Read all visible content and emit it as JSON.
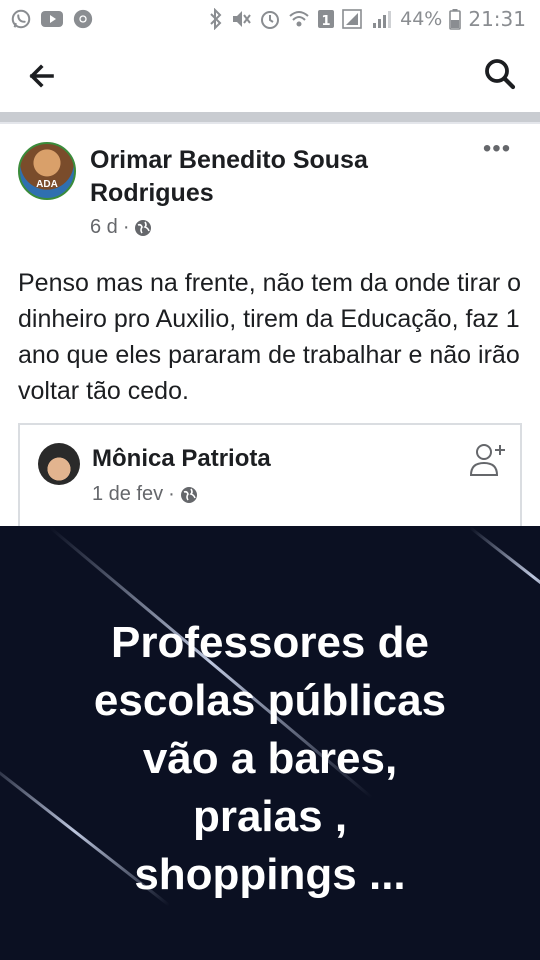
{
  "status_bar": {
    "battery_percent": "44%",
    "time": "21:31",
    "left_icons": [
      "whatsapp-icon",
      "youtube-icon",
      "chrome-icon"
    ],
    "right_icons": [
      "bluetooth-icon",
      "mute-icon",
      "alarm-icon",
      "wifi-icon",
      "sim-1-icon",
      "signal-icon",
      "signal-icon",
      "battery-icon"
    ]
  },
  "app_bar": {
    "back_icon": "arrow-left-icon",
    "search_icon": "search-icon"
  },
  "post": {
    "author": "Orimar Benedito Sousa Rodrigues",
    "avatar_text": "ADA",
    "timestamp": "6 d",
    "separator": "·",
    "privacy_icon": "globe-icon",
    "more_icon": "•••",
    "text": "Penso mas na frente, não tem da onde tirar o dinheiro pro Auxilio, tirem da Educação, faz 1 ano que eles pararam de trabalhar e não irão voltar tão cedo."
  },
  "shared_post": {
    "author": "Mônica Patriota",
    "timestamp": "1 de fev",
    "separator": "·",
    "privacy_icon": "globe-icon",
    "action_icon": "add-friend-icon"
  },
  "image": {
    "background_color": "#0b1022",
    "caption_lines": [
      "Professores de",
      "escolas públicas",
      "vão a bares,",
      "praias ,",
      "shoppings ..."
    ]
  },
  "colors": {
    "text_primary": "#1c1e21",
    "text_secondary": "#65676b",
    "separator_bar": "#c9ccd1"
  }
}
